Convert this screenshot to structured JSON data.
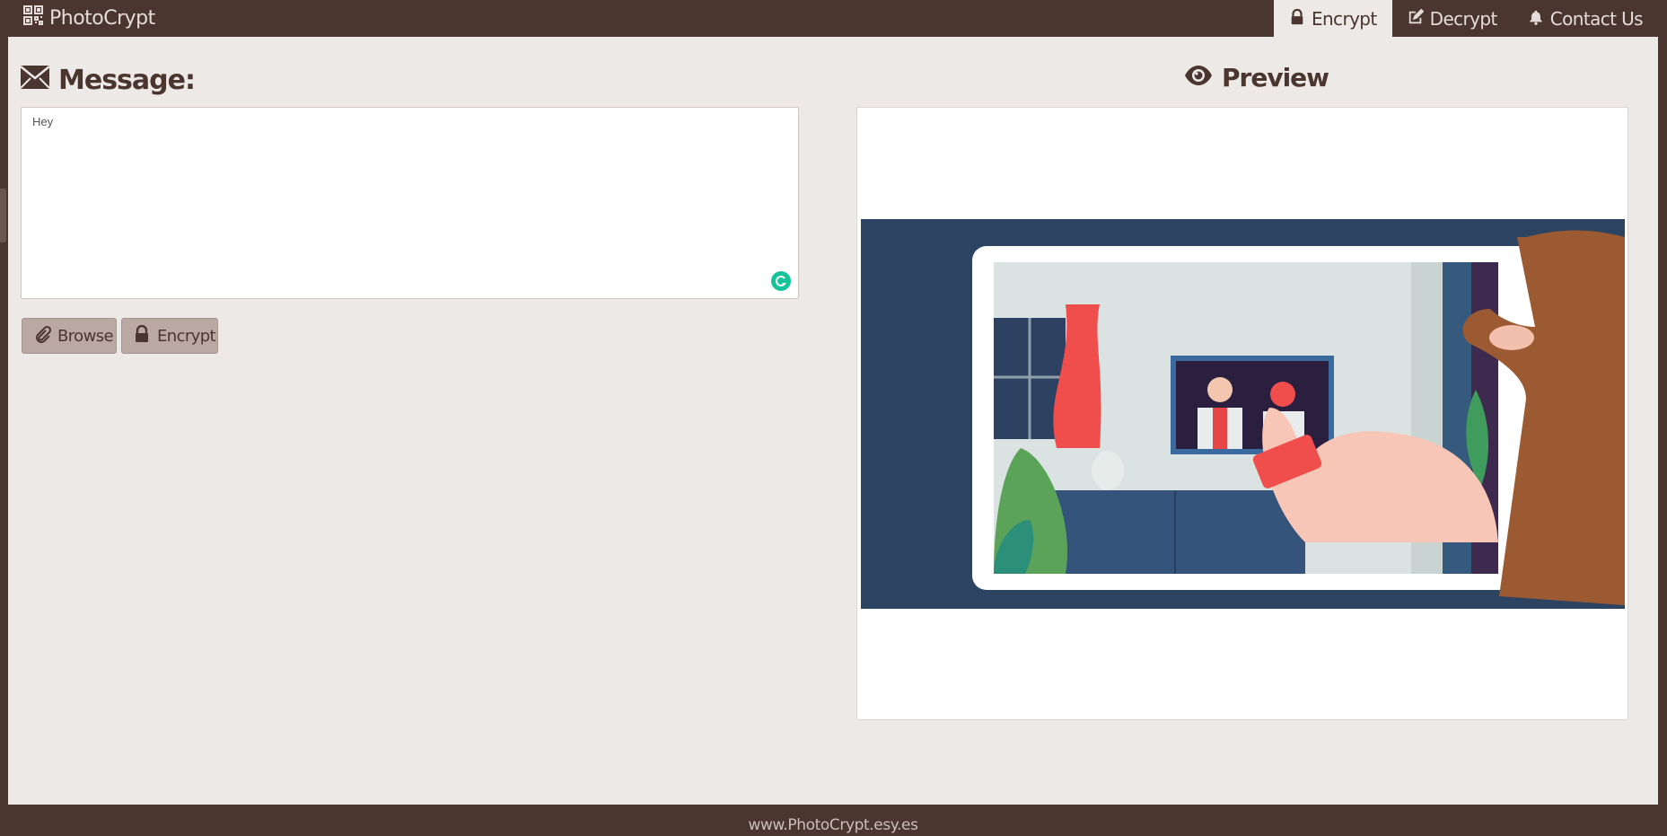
{
  "navbar": {
    "brand": "PhotoCrypt",
    "brand_icon": "qrcode-icon",
    "items": [
      {
        "label": "Encrypt",
        "icon": "lock-icon",
        "active": true
      },
      {
        "label": "Decrypt",
        "icon": "edit-icon",
        "active": false
      },
      {
        "label": "Contact Us",
        "icon": "bell-icon",
        "active": false
      }
    ]
  },
  "message": {
    "heading": "Message:",
    "icon": "envelope-icon",
    "value": "Hey"
  },
  "buttons": {
    "browse_label": "Browse",
    "encrypt_label": "Encrypt"
  },
  "preview": {
    "heading": "Preview",
    "icon": "eye-icon",
    "image_alt": "Illustration of a hand holding a tablet showing a video call"
  },
  "footer": {
    "text": "www.PhotoCrypt.esy.es"
  },
  "colors": {
    "primary": "#4a352f",
    "background": "#ede9e6",
    "button": "#baa9a3",
    "grammarly": "#15c39a"
  }
}
